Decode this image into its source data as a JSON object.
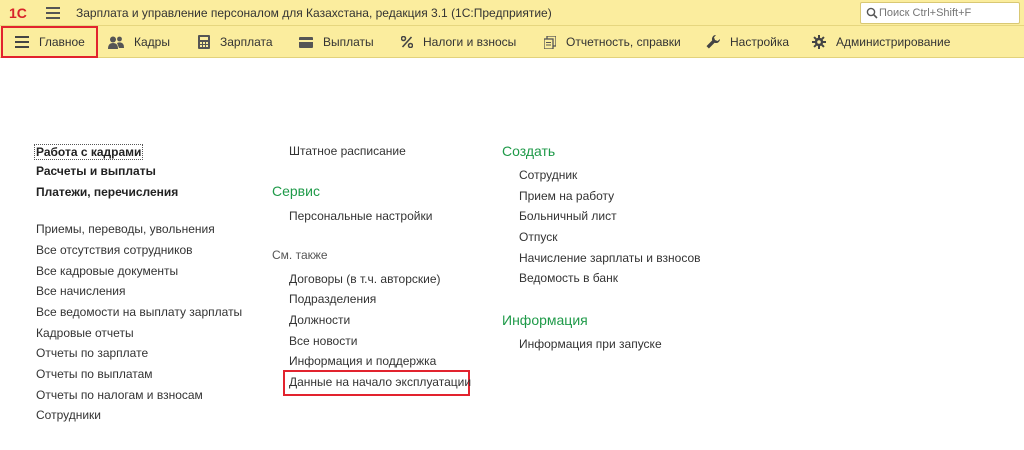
{
  "window": {
    "title": "Зарплата и управление персоналом для Казахстана, редакция 3.1  (1С:Предприятие)",
    "logo_text": "1С",
    "search_placeholder": "Поиск Ctrl+Shift+F"
  },
  "sections": [
    {
      "label": "Главное",
      "icon": "list-icon",
      "active": true
    },
    {
      "label": "Кадры",
      "icon": "people-icon"
    },
    {
      "label": "Зарплата",
      "icon": "calculator-icon"
    },
    {
      "label": "Выплаты",
      "icon": "wallet-icon"
    },
    {
      "label": "Налоги и взносы",
      "icon": "percent-icon"
    },
    {
      "label": "Отчетность, справки",
      "icon": "documents-icon"
    },
    {
      "label": "Настройка",
      "icon": "wrench-icon"
    },
    {
      "label": "Администрирование",
      "icon": "gear-icon"
    }
  ],
  "col1": {
    "bold_links": [
      "Работа с кадрами",
      "Расчеты и выплаты",
      "Платежи, перечисления"
    ],
    "links": [
      "Приемы, переводы, увольнения",
      "Все отсутствия сотрудников",
      "Все кадровые документы",
      "Все начисления",
      "Все ведомости на выплату зарплаты",
      "Кадровые отчеты",
      "Отчеты по зарплате",
      "Отчеты по выплатам",
      "Отчеты по налогам и взносам",
      "Сотрудники"
    ]
  },
  "col2": {
    "top_link": "Штатное расписание",
    "service_title": "Сервис",
    "service_links": [
      "Персональные настройки"
    ],
    "see_also_title": "См. также",
    "see_also_links": [
      "Договоры (в т.ч. авторские)",
      "Подразделения",
      "Должности",
      "Все новости",
      "Информация и поддержка",
      "Данные на начало эксплуатации"
    ]
  },
  "col3": {
    "create_title": "Создать",
    "create_links": [
      "Сотрудник",
      "Прием на работу",
      "Больничный лист",
      "Отпуск",
      "Начисление зарплаты и взносов",
      "Ведомость в банк"
    ],
    "info_title": "Информация",
    "info_links": [
      "Информация при запуске"
    ]
  },
  "colors": {
    "panel": "#fbed9e",
    "group_title": "#1f9a49",
    "highlight": "#e2232e"
  }
}
